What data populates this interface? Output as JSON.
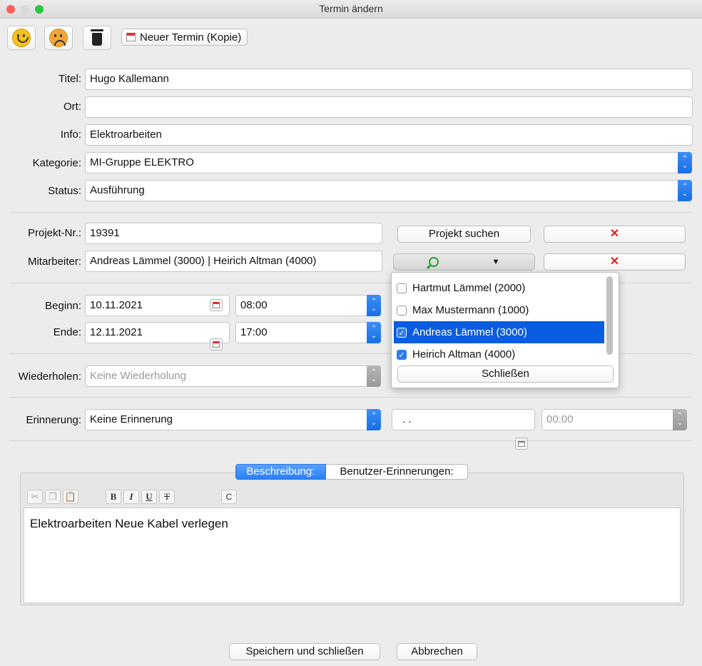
{
  "window": {
    "title": "Termin ändern"
  },
  "toolbar": {
    "new_appointment_copy": "Neuer Termin (Kopie)"
  },
  "form": {
    "titel": {
      "label": "Titel:",
      "value": "Hugo Kallemann"
    },
    "ort": {
      "label": "Ort:",
      "value": ""
    },
    "info": {
      "label": "Info:",
      "value": "Elektroarbeiten"
    },
    "kategorie": {
      "label": "Kategorie:",
      "value": "MI-Gruppe ELEKTRO"
    },
    "status": {
      "label": "Status:",
      "value": "Ausführung"
    },
    "projekt_nr": {
      "label": "Projekt-Nr.:",
      "value": "19391"
    },
    "projekt_suchen": "Projekt suchen",
    "mitarbeiter": {
      "label": "Mitarbeiter:",
      "value": "Andreas Lämmel (3000) | Heirich Altman (4000)"
    },
    "beginn": {
      "label": "Beginn:",
      "date": "10.11.2021",
      "time": "08:00"
    },
    "ende": {
      "label": "Ende:",
      "date": "12.11.2021",
      "time": "17:00"
    },
    "wiederholen": {
      "label": "Wiederholen:",
      "value": "Keine Wiederholung"
    },
    "erinnerung": {
      "label": "Erinnerung:",
      "value": "Keine Erinnerung",
      "date": ". .",
      "time": "00:00"
    },
    "clear_symbol": "✕"
  },
  "employee_dropdown": {
    "items": [
      {
        "label": "Hartmut Lämmel (2000)",
        "checked": false
      },
      {
        "label": "Max Mustermann (1000)",
        "checked": false
      },
      {
        "label": "Andreas Lämmel (3000)",
        "checked": true
      },
      {
        "label": "Heirich Altman (4000)",
        "checked": true
      }
    ],
    "close_label": "Schließen",
    "check_mark": "✓"
  },
  "tabs": {
    "description": "Beschreibung:",
    "user_reminders": "Benutzer-Erinnerungen:"
  },
  "editor": {
    "bold": "B",
    "italic": "I",
    "underline": "U",
    "strike": "T",
    "clear": "C",
    "content": "Elektroarbeiten Neue Kabel verlegen"
  },
  "footer": {
    "save_close": "Speichern und schließen",
    "cancel": "Abbrechen"
  },
  "colors": {
    "accent": "#1a6ee6",
    "selection": "#0a5ce0",
    "clear_x": "#e02020",
    "search_green": "#2aa52a"
  }
}
